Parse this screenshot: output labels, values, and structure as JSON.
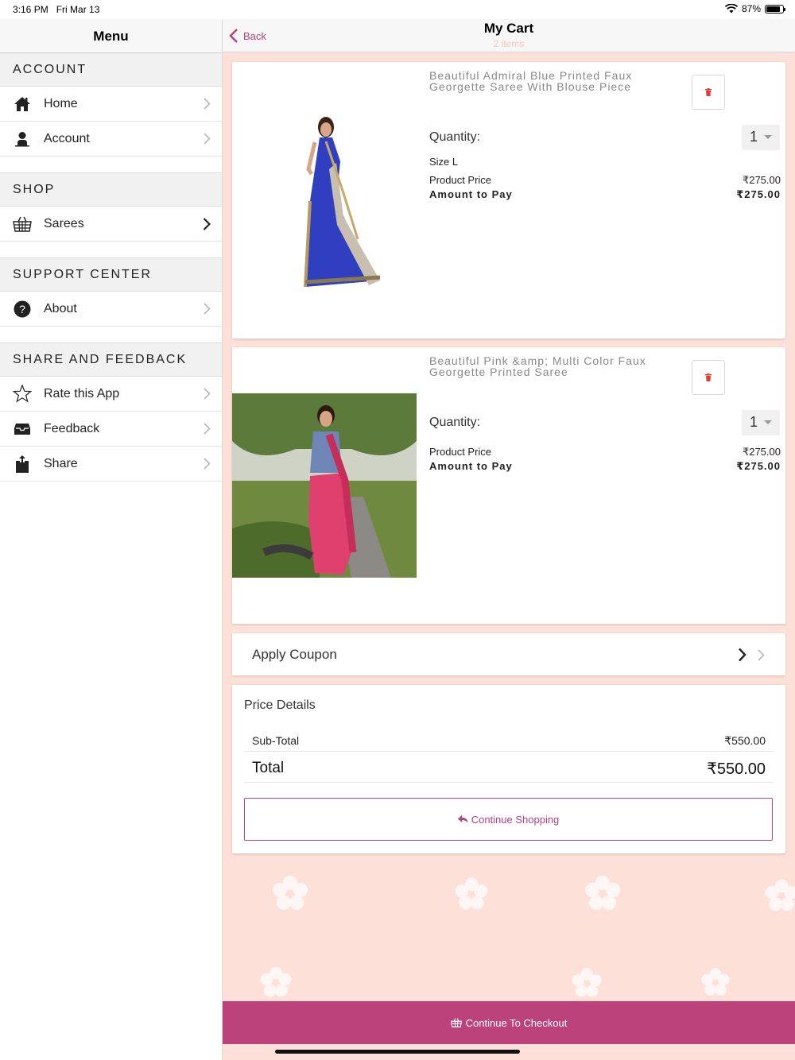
{
  "status": {
    "time": "3:16 PM",
    "date": "Fri Mar 13",
    "battery": "87%",
    "battery_level": 0.87
  },
  "sidebar": {
    "title": "Menu",
    "sections": {
      "account": {
        "title": "ACCOUNT",
        "items": [
          {
            "label": "Home",
            "icon": "home-icon"
          },
          {
            "label": "Account",
            "icon": "user-icon"
          }
        ]
      },
      "shop": {
        "title": "SHOP",
        "items": [
          {
            "label": "Sarees",
            "icon": "basket-icon"
          }
        ]
      },
      "support": {
        "title": "SUPPORT CENTER",
        "items": [
          {
            "label": "About",
            "icon": "help-icon"
          }
        ]
      },
      "share": {
        "title": "SHARE AND FEEDBACK",
        "items": [
          {
            "label": "Rate this App",
            "icon": "star-icon"
          },
          {
            "label": "Feedback",
            "icon": "inbox-icon"
          },
          {
            "label": "Share",
            "icon": "share-icon"
          }
        ]
      }
    }
  },
  "nav": {
    "back": "Back",
    "title": "My Cart",
    "subtitle": "2 items"
  },
  "cart": {
    "items": [
      {
        "name": "Beautiful Admiral Blue Printed Faux Georgette Saree With Blouse Piece",
        "quantity_label": "Quantity:",
        "quantity": "1",
        "size": "Size L",
        "price_label": "Product Price",
        "price": "₹275.00",
        "pay_label": "Amount to Pay",
        "pay": "₹275.00"
      },
      {
        "name": "Beautiful Pink &amp; Multi Color Faux Georgette Printed Saree",
        "quantity_label": "Quantity:",
        "quantity": "1",
        "price_label": "Product Price",
        "price": "₹275.00",
        "pay_label": "Amount to Pay",
        "pay": "₹275.00"
      }
    ]
  },
  "coupon": {
    "label": "Apply Coupon"
  },
  "price_details": {
    "title": "Price Details",
    "subtotal_label": "Sub-Total",
    "subtotal": "₹550.00",
    "total_label": "Total",
    "total": "₹550.00",
    "continue_shopping": "Continue Shopping"
  },
  "checkout": {
    "label": "Continue To Checkout"
  },
  "colors": {
    "accent": "#bb427a",
    "background": "#fde1d8",
    "delete": "#e53935"
  }
}
